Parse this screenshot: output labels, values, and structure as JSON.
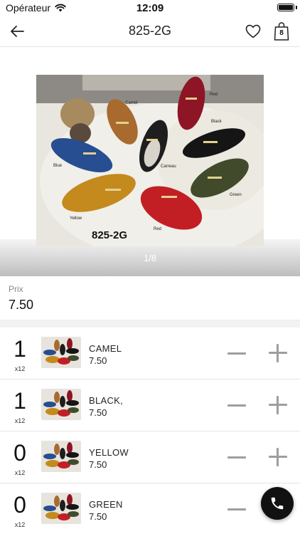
{
  "status_bar": {
    "carrier": "Opérateur",
    "time": "12:09"
  },
  "nav": {
    "title": "825-2G",
    "cart_count": "8"
  },
  "gallery": {
    "pager": "1/8",
    "photo_caption": "825-2G",
    "photo_labels": {
      "blue": "Blue",
      "camel": "Camel",
      "black": "Black",
      "red_top": "Red",
      "carreau": "Carreau",
      "green": "Green",
      "yellow": "Yellow",
      "red_bottom": "Red"
    }
  },
  "price": {
    "label": "Prix",
    "value": "7.50"
  },
  "variants": [
    {
      "qty": "1",
      "unit": "x12",
      "name": "CAMEL",
      "price": "7.50"
    },
    {
      "qty": "1",
      "unit": "x12",
      "name": "BLACK,",
      "price": "7.50"
    },
    {
      "qty": "0",
      "unit": "x12",
      "name": "YELLOW",
      "price": "7.50"
    },
    {
      "qty": "0",
      "unit": "x12",
      "name": "GREEN",
      "price": "7.50"
    }
  ],
  "icons": {
    "back": "arrow-left-icon",
    "favorite": "heart-icon",
    "cart": "shopping-bag-icon",
    "call": "phone-icon",
    "wifi": "wifi-icon",
    "battery": "battery-icon"
  },
  "colors": {
    "accent": "#111111",
    "control_gray": "#9e9e9e"
  }
}
